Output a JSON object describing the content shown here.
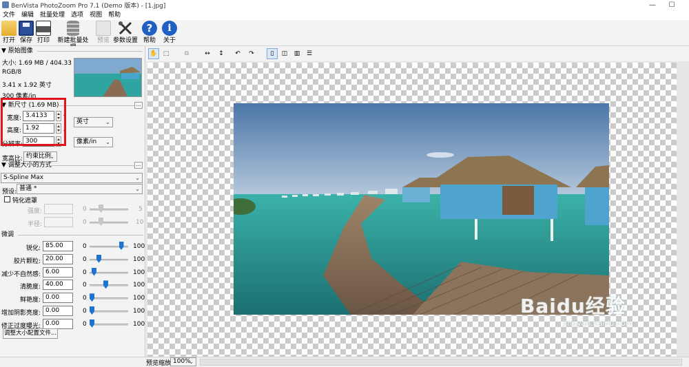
{
  "window": {
    "title": "BenVista PhotoZoom Pro 7.1 (Demo 版本) - [1.jpg]",
    "minimize": "—",
    "maximize": "☐"
  },
  "menu": [
    "文件",
    "编辑",
    "批量处理",
    "选项",
    "视图",
    "帮助"
  ],
  "toolbar": {
    "open": "打开",
    "save": "保存",
    "print": "打印",
    "batch": "新建批量处理",
    "preview": "预览",
    "settings": "参数设置",
    "help": "帮助",
    "about": "关于"
  },
  "original": {
    "header": "▼ 原始图像",
    "size": "大小: 1.69 MB / 404.33 KB",
    "mode": "RGB/8",
    "dims": "3.41 x 1.92 英寸",
    "res": "300 像素/in"
  },
  "newsize": {
    "header": "▼ 新尺寸 (1.69 MB)",
    "width_label": "宽度:",
    "width_value": "3.4133",
    "height_label": "高度:",
    "height_value": "1.92",
    "res_label": "分辨率:",
    "res_value": "300",
    "unit": "英寸",
    "res_unit": "像素/in",
    "aspect_label": "宽高比:",
    "aspect_value": "约束比例"
  },
  "method": {
    "header": "▼ 调整大小的方式",
    "algorithm": "S-Spline Max",
    "preset_label": "预设:",
    "preset_value": "普通 *",
    "sharpen_mask": "钝化遮罩",
    "strength_label": "强度:",
    "radius_label": "半径:",
    "strength_min": "0",
    "strength_max": "5",
    "radius_min": "0",
    "radius_max": "10"
  },
  "finetune": {
    "header": "微调",
    "rows": [
      {
        "label": "锐化:",
        "value": "85.00",
        "min": "0",
        "max": "100",
        "level": 0.85
      },
      {
        "label": "胶片颗粒:",
        "value": "20.00",
        "min": "0",
        "max": "100",
        "level": 0.2
      },
      {
        "label": "减少不自然感:",
        "value": "6.00",
        "min": "0",
        "max": "100",
        "level": 0.06
      },
      {
        "label": "清脆度:",
        "value": "40.00",
        "min": "0",
        "max": "100",
        "level": 0.4
      },
      {
        "label": "鲜艳度:",
        "value": "0.00",
        "min": "0",
        "max": "100",
        "level": 0
      },
      {
        "label": "增加阴影亮度:",
        "value": "0.00",
        "min": "0",
        "max": "100",
        "level": 0
      },
      {
        "label": "修正过度曝光:",
        "value": "0.00",
        "min": "0",
        "max": "100",
        "level": 0
      }
    ],
    "profile_button": "调整大小配置文件..."
  },
  "status": {
    "zoom_label": "预览缩放:",
    "zoom_value": "100%"
  },
  "watermark": {
    "brand": "Baidu经验",
    "url": "jingyan.baidu.com"
  },
  "colors": {
    "accent": "#1e74d0",
    "highlight": "#e3141c"
  }
}
